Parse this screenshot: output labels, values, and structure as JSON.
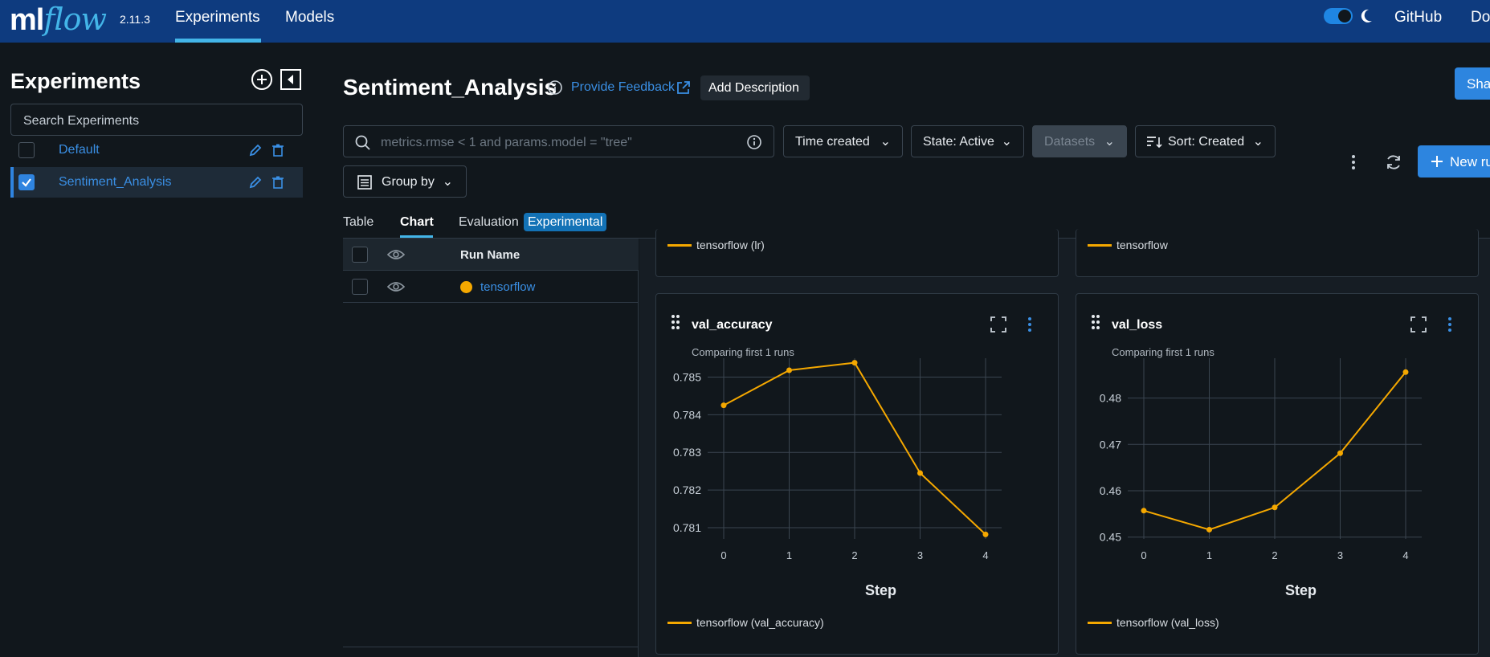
{
  "topbar": {
    "logo_ml": "ml",
    "logo_flow": "flow",
    "version": "2.11.3",
    "nav": [
      "Experiments",
      "Models"
    ],
    "right_links": [
      "GitHub",
      "Do"
    ]
  },
  "sidebar": {
    "heading": "Experiments",
    "search_placeholder": "Search Experiments",
    "experiments": [
      {
        "name": "Default",
        "checked": false
      },
      {
        "name": "Sentiment_Analysis",
        "checked": true
      }
    ]
  },
  "header": {
    "title": "Sentiment_Analysis",
    "feedback": "Provide Feedback",
    "add_description": "Add Description",
    "share": "Shar"
  },
  "filters": {
    "search_placeholder": "metrics.rmse < 1 and params.model = \"tree\"",
    "time_created": "Time created",
    "state": "State: Active",
    "datasets": "Datasets",
    "sort": "Sort: Created",
    "new_run": "New ru",
    "group_by": "Group by"
  },
  "tabs": {
    "items": [
      "Table",
      "Chart",
      "Evaluation"
    ],
    "active": "Chart",
    "badge": "Experimental"
  },
  "runs_table": {
    "header": "Run Name",
    "rows": [
      {
        "name": "tensorflow",
        "color": "#f5a800"
      }
    ]
  },
  "top_cards": {
    "left_legend": "tensorflow (lr)",
    "right_legend": "tensorflow"
  },
  "chart_data": [
    {
      "type": "line",
      "title": "val_accuracy",
      "subtitle": "Comparing first 1 runs",
      "xlabel": "Step",
      "ylabel": "",
      "x": [
        0,
        1,
        2,
        3,
        4
      ],
      "series": [
        {
          "name": "tensorflow (val_accuracy)",
          "values": [
            0.78425,
            0.78518,
            0.78538,
            0.78245,
            0.78082
          ],
          "color": "#f5a800"
        }
      ],
      "xticks": [
        "0",
        "1",
        "2",
        "3",
        "4"
      ],
      "yticks": [
        "0.781",
        "0.782",
        "0.783",
        "0.784",
        "0.785"
      ],
      "ylim": [
        0.7807,
        0.7855
      ],
      "grid": true
    },
    {
      "type": "line",
      "title": "val_loss",
      "subtitle": "Comparing first 1 runs",
      "xlabel": "Step",
      "ylabel": "",
      "x": [
        0,
        1,
        2,
        3,
        4
      ],
      "series": [
        {
          "name": "tensorflow (val_loss)",
          "values": [
            0.4557,
            0.4516,
            0.4564,
            0.4681,
            0.4856
          ],
          "color": "#f5a800"
        }
      ],
      "xticks": [
        "0",
        "1",
        "2",
        "3",
        "4"
      ],
      "yticks": [
        "0.45",
        "0.46",
        "0.47",
        "0.48"
      ],
      "ylim": [
        0.4496,
        0.4886
      ],
      "grid": true
    }
  ]
}
